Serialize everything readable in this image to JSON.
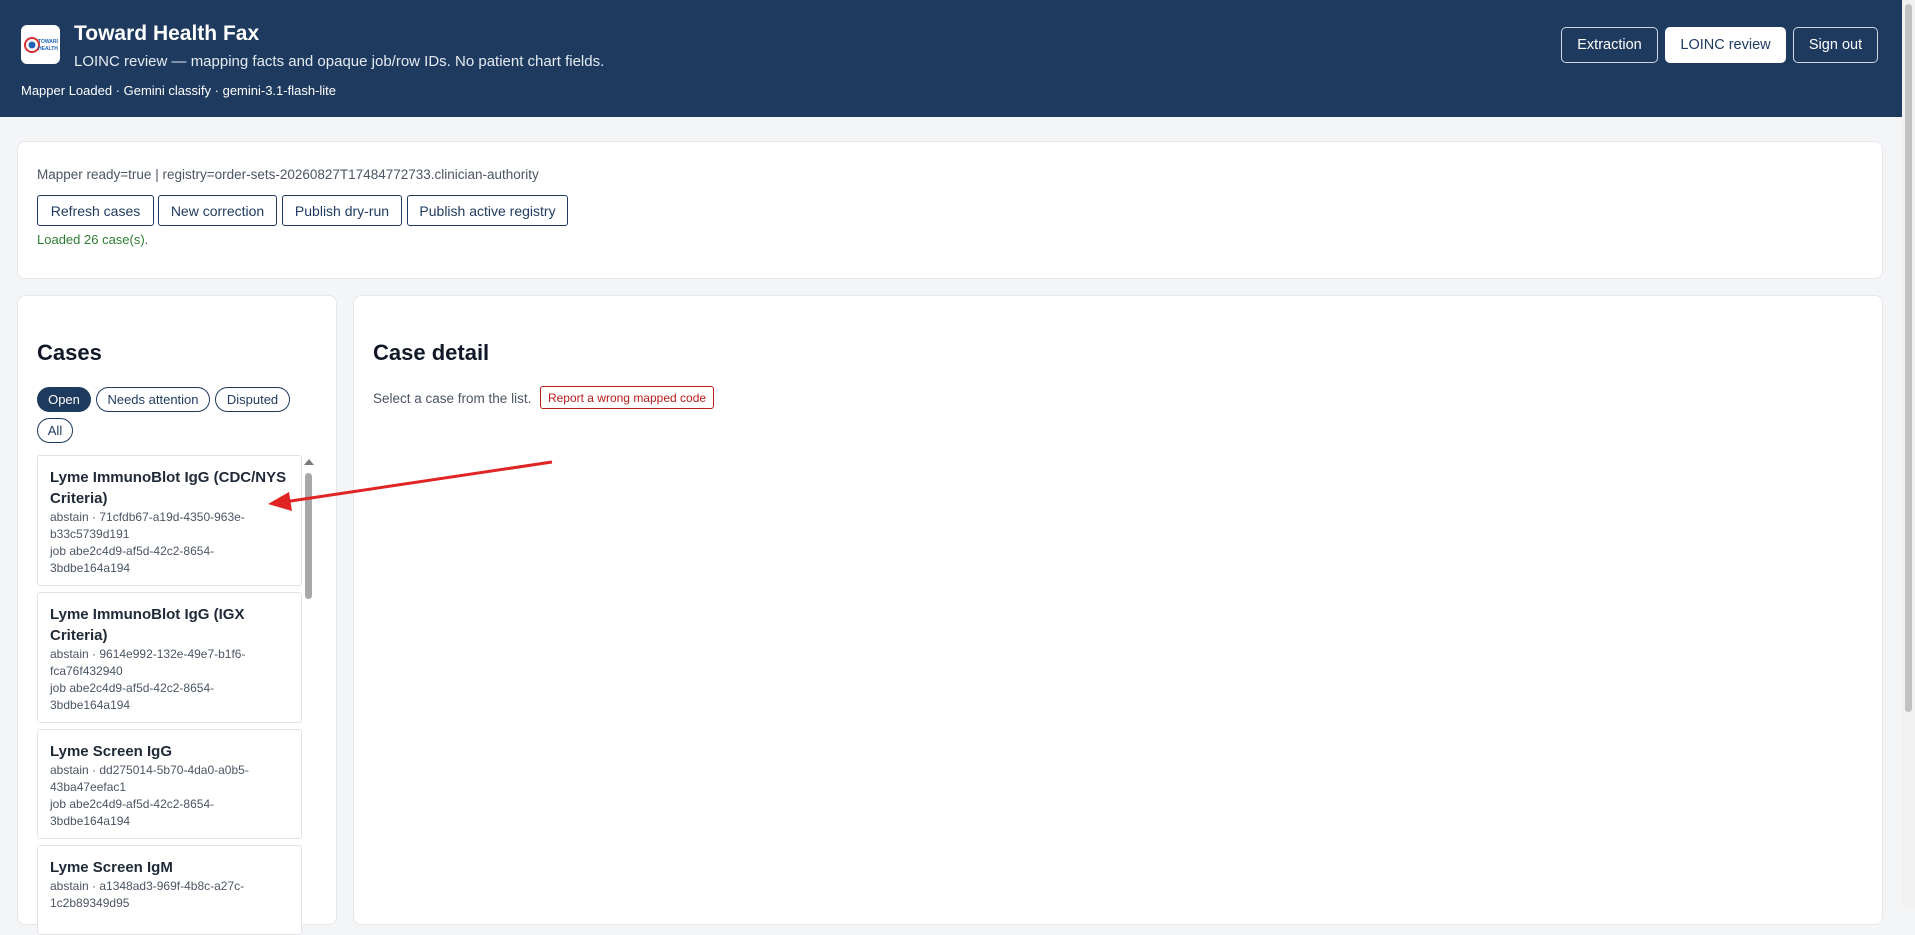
{
  "header": {
    "logo_text": "TOWARD HEALTH",
    "title": "Toward Health Fax",
    "subtitle": "LOINC review — mapping facts and opaque job/row IDs. No patient chart fields.",
    "status": "Mapper Loaded · Gemini classify · gemini-3.1-flash-lite",
    "nav": [
      {
        "label": "Extraction",
        "active": false
      },
      {
        "label": "LOINC review",
        "active": true
      },
      {
        "label": "Sign out",
        "active": false
      }
    ]
  },
  "toolbar": {
    "mapper_info": "Mapper ready=true | registry=order-sets-20260827T17484772733.clinician-authority",
    "buttons": [
      "Refresh cases",
      "New correction",
      "Publish dry-run",
      "Publish active registry"
    ],
    "loaded_message": "Loaded 26 case(s)."
  },
  "cases": {
    "heading": "Cases",
    "filters": [
      {
        "label": "Open",
        "active": true
      },
      {
        "label": "Needs attention",
        "active": false
      },
      {
        "label": "Disputed",
        "active": false
      },
      {
        "label": "All",
        "active": false
      }
    ],
    "items": [
      {
        "title": "Lyme ImmunoBlot IgG (CDC/NYS Criteria)",
        "meta1": "abstain · 71cfdb67-a19d-4350-963e-b33c5739d191",
        "meta2": "job abe2c4d9-af5d-42c2-8654-3bdbe164a194"
      },
      {
        "title": "Lyme ImmunoBlot IgG (IGX Criteria)",
        "meta1": "abstain · 9614e992-132e-49e7-b1f6-fca76f432940",
        "meta2": "job abe2c4d9-af5d-42c2-8654-3bdbe164a194"
      },
      {
        "title": "Lyme Screen IgG",
        "meta1": "abstain · dd275014-5b70-4da0-a0b5-43ba47eefac1",
        "meta2": "job abe2c4d9-af5d-42c2-8654-3bdbe164a194"
      },
      {
        "title": "Lyme Screen IgM",
        "meta1": "abstain · a1348ad3-969f-4b8c-a27c-1c2b89349d95",
        "meta2": ""
      }
    ]
  },
  "detail": {
    "heading": "Case detail",
    "hint": "Select a case from the list.",
    "report_button": "Report a wrong mapped code"
  },
  "colors": {
    "header_bg": "#1e3a5f",
    "success": "#2e7d32",
    "danger": "#b91c1c",
    "annotation_arrow": "#e02424"
  }
}
